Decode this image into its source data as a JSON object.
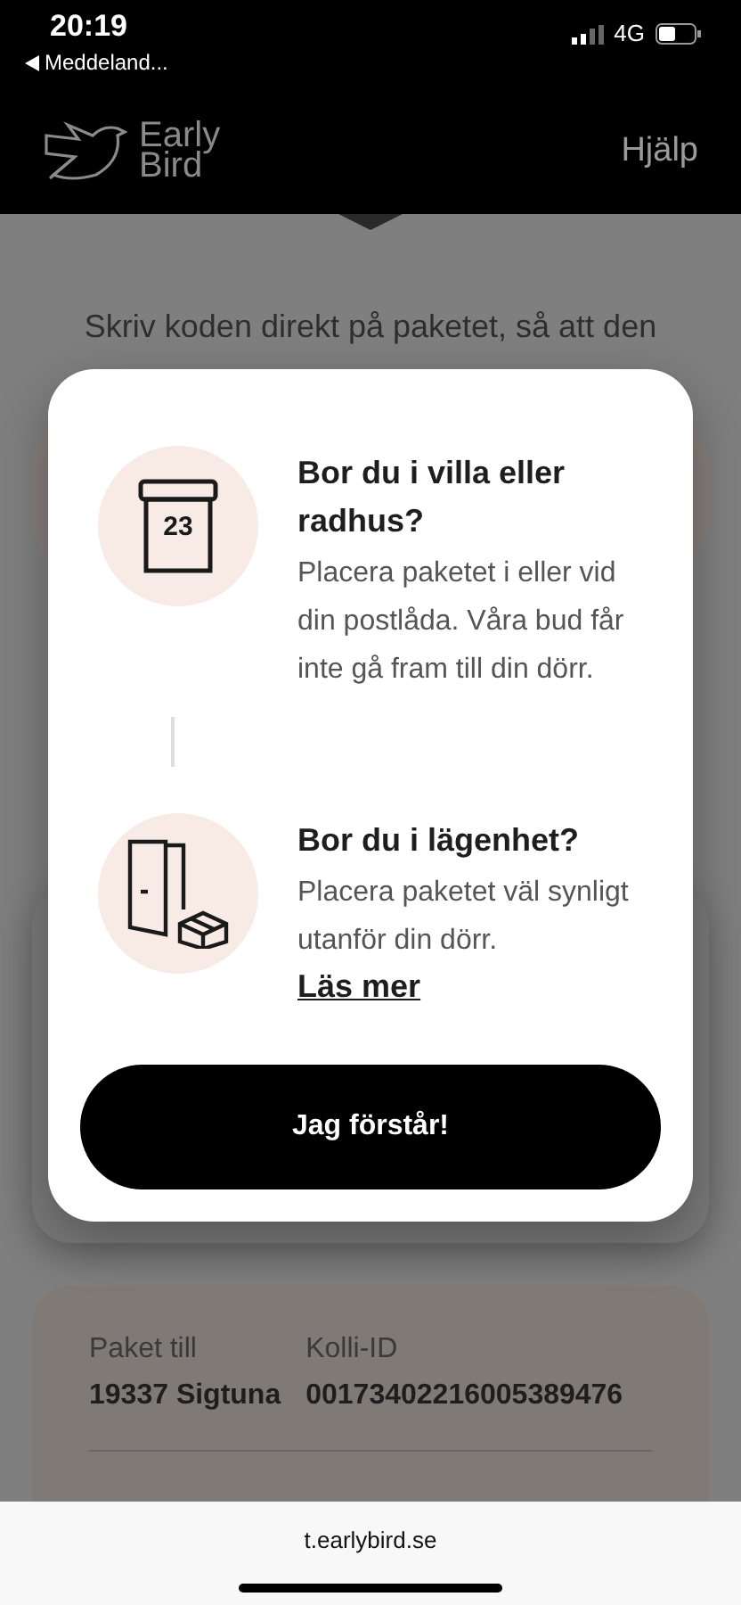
{
  "status_bar": {
    "time": "20:19",
    "back_app": "Meddeland...",
    "network": "4G"
  },
  "header": {
    "logo_lines": [
      "Early",
      "Bird"
    ],
    "help": "Hjälp"
  },
  "page": {
    "instruction": "Skriv koden direkt på paketet, så att den"
  },
  "modal": {
    "options": [
      {
        "kind": "mailbox",
        "badge": "23",
        "title": "Bor du i villa eller radhus?",
        "body": "Placera paketet i eller vid din postlåda. Våra bud får inte gå fram till din dörr."
      },
      {
        "kind": "door",
        "title": "Bor du i lägenhet?",
        "body": "Placera paketet väl synligt utanför din dörr.",
        "link": "Läs mer"
      }
    ],
    "button": "Jag förstår!"
  },
  "package_card": {
    "fields": [
      {
        "label": "Paket till",
        "value": "19337 Sigtuna"
      },
      {
        "label": "Kolli-ID",
        "value": "00173402216005389476"
      }
    ]
  },
  "browser_bar": {
    "url": "t.earlybird.se"
  }
}
